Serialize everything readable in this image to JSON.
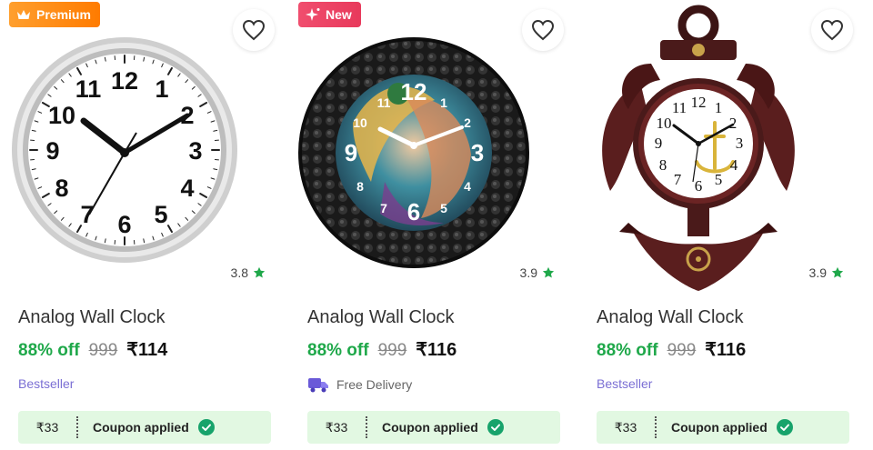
{
  "products": [
    {
      "badge": {
        "label": "Premium",
        "icon": "crown-icon",
        "color": "#ff8a00"
      },
      "rating": "3.8",
      "title": "Analog Wall Clock",
      "discount": "88% off",
      "mrp": "999",
      "price": "₹114",
      "tag": "Bestseller",
      "coupon_amount": "₹33",
      "coupon_label": "Coupon applied"
    },
    {
      "badge": {
        "label": "New",
        "icon": "sparkle-icon",
        "color": "#e8395b"
      },
      "rating": "3.9",
      "title": "Analog Wall Clock",
      "discount": "88% off",
      "mrp": "999",
      "price": "₹116",
      "tag": "Free Delivery",
      "tag_icon": "delivery-truck-icon",
      "coupon_amount": "₹33",
      "coupon_label": "Coupon applied"
    },
    {
      "rating": "3.9",
      "title": "Analog Wall Clock",
      "discount": "88% off",
      "mrp": "999",
      "price": "₹116",
      "tag": "Bestseller",
      "coupon_amount": "₹33",
      "coupon_label": "Coupon applied"
    }
  ],
  "clock_numerals": [
    "12",
    "1",
    "2",
    "3",
    "4",
    "5",
    "6",
    "7",
    "8",
    "9",
    "10",
    "11"
  ],
  "colors": {
    "discount_green": "#1fa84a",
    "rating_star": "#1fa84a",
    "bestseller": "#7b6fd4",
    "coupon_bg": "#e2f8e2"
  }
}
